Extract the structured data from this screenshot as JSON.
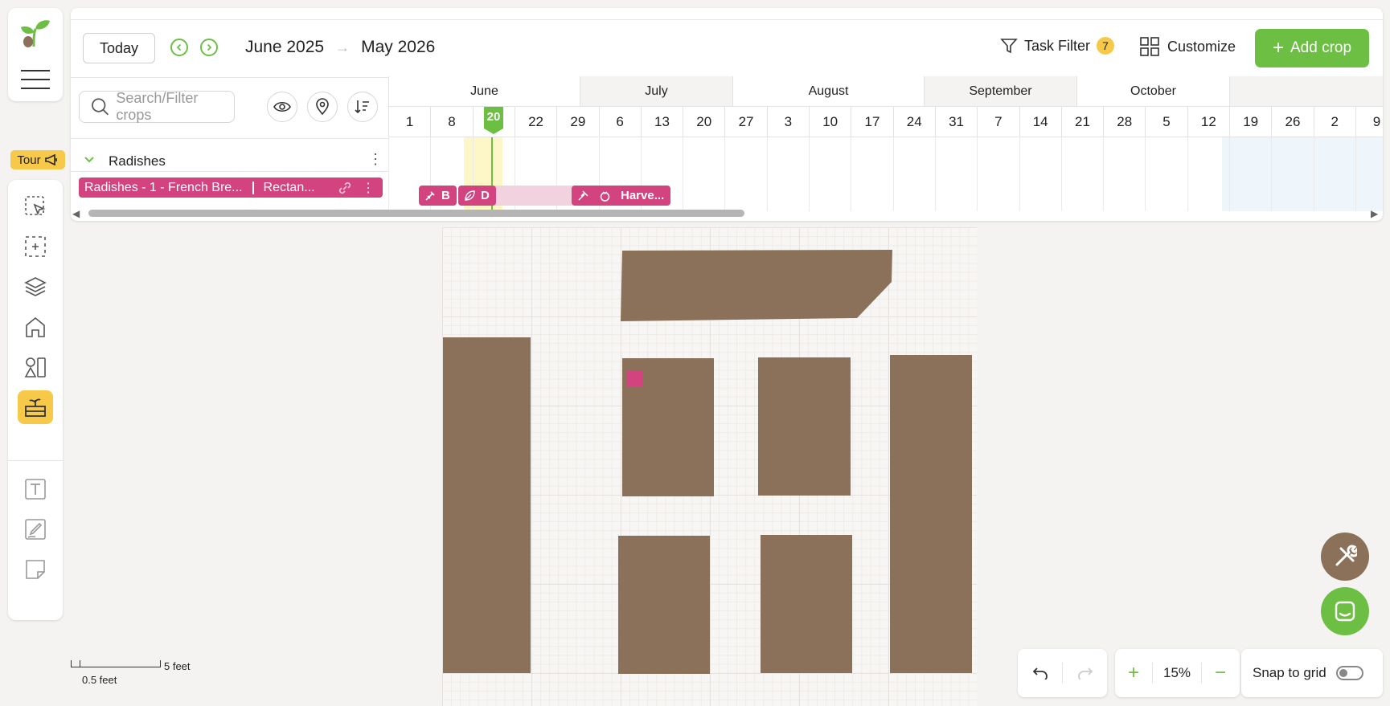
{
  "left_toolbar": {
    "tour_label": "Tour"
  },
  "header": {
    "today_label": "Today",
    "range_start": "June 2025",
    "range_sep": "→",
    "range_end": "May 2026",
    "task_filter_label": "Task Filter",
    "task_filter_count": "7",
    "customize_label": "Customize",
    "add_crop_label": "Add crop"
  },
  "crop_list": {
    "search_placeholder": "Search/Filter crops",
    "group_name": "Radishes",
    "crop_name": "Radishes - 1 - French Bre...",
    "crop_bed": "Rectan..."
  },
  "timeline": {
    "months": [
      "June",
      "July",
      "August",
      "September",
      "October"
    ],
    "weeks": [
      "1",
      "8",
      "15",
      "22",
      "29",
      "6",
      "13",
      "20",
      "27",
      "3",
      "10",
      "17",
      "24",
      "31",
      "7",
      "14",
      "21",
      "28",
      "5",
      "12",
      "19",
      "26",
      "2",
      "9"
    ],
    "today_marker": "20",
    "tasks": [
      {
        "label": "B",
        "icon": "sow-icon"
      },
      {
        "label": "D",
        "icon": "leaf-icon"
      },
      {
        "label": "Harve...",
        "icon": "harvest-icon"
      }
    ]
  },
  "canvas": {
    "zoom": "15%",
    "snap_label": "Snap to grid",
    "snap_on": false,
    "scale_label_top": "5 feet",
    "scale_label_bottom": "0.5 feet"
  },
  "colors": {
    "accent": "#6dbf43",
    "crop": "#d3437f",
    "bed": "#8b7159",
    "highlight": "#f7c948"
  }
}
